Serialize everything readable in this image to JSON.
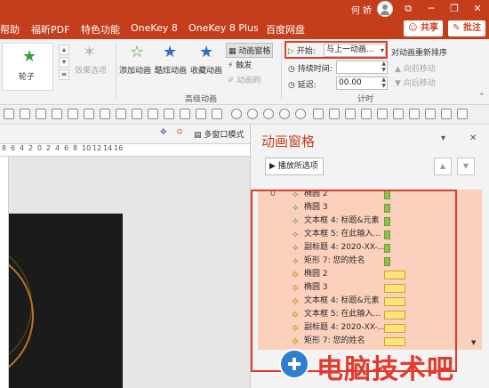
{
  "titlebar": {
    "user": "何 娇",
    "controls": [
      "⧉",
      "─",
      "❐",
      "✕"
    ]
  },
  "menubar": {
    "items": [
      "帮助",
      "福昕PDF",
      "特色功能",
      "OneKey 8",
      "OneKey 8 Plus",
      "百度网盘"
    ],
    "share": "共享",
    "comment": "批注"
  },
  "ribbon": {
    "thumb_label": "轮子",
    "effect_options": "效果选项",
    "add_animation": "添加动画",
    "cool_animation": "酷炫动画",
    "fav_animation": "收藏动画",
    "anim_pane": "动画窗格",
    "trigger": "触发",
    "anim_brush": "动画刷",
    "advanced_group": "高级动画",
    "start_label": "开始:",
    "start_value": "与上一动画...",
    "duration_label": "持续时间:",
    "delay_label": "延迟:",
    "delay_value": "00.00",
    "timing_group": "计时",
    "reorder_title": "对动画重新排序",
    "move_earlier": "向前移动",
    "move_later": "向后移动"
  },
  "slide": {
    "multiwindow": "多窗口模式",
    "ruler_ticks": [
      "8",
      "6",
      "4",
      "2",
      "0",
      "2",
      "4",
      "6",
      "8",
      "10",
      "12",
      "14",
      "16"
    ]
  },
  "pane": {
    "title": "动画窗格",
    "play_button": "播放所选项",
    "first_index": "0",
    "items": [
      {
        "label": "椭圆 2",
        "kind": "entrance"
      },
      {
        "label": "椭圆 3",
        "kind": "entrance"
      },
      {
        "label": "文本框 4: 标题&元素",
        "kind": "entrance"
      },
      {
        "label": "文本框 5: 在此输入...",
        "kind": "entrance"
      },
      {
        "label": "副标题 4: 2020-XX-...",
        "kind": "entrance"
      },
      {
        "label": "矩形 7: 您的姓名",
        "kind": "entrance"
      },
      {
        "label": "椭圆 2",
        "kind": "emphasis"
      },
      {
        "label": "椭圆 3",
        "kind": "emphasis"
      },
      {
        "label": "文本框 4: 标题&元素",
        "kind": "emphasis"
      },
      {
        "label": "文本框 5: 在此输入...",
        "kind": "emphasis"
      },
      {
        "label": "副标题 4: 2020-XX-...",
        "kind": "emphasis"
      },
      {
        "label": "矩形 7: 您的姓名",
        "kind": "emphasis"
      }
    ]
  },
  "watermark": {
    "text": "电脑技术吧"
  },
  "colors": {
    "accent": "#c43e1c",
    "highlight_frame": "#e23b2e",
    "list_bg": "#fbd0bc",
    "entrance_bar": "#8ac440",
    "emphasis_bar": "#fde37a"
  }
}
